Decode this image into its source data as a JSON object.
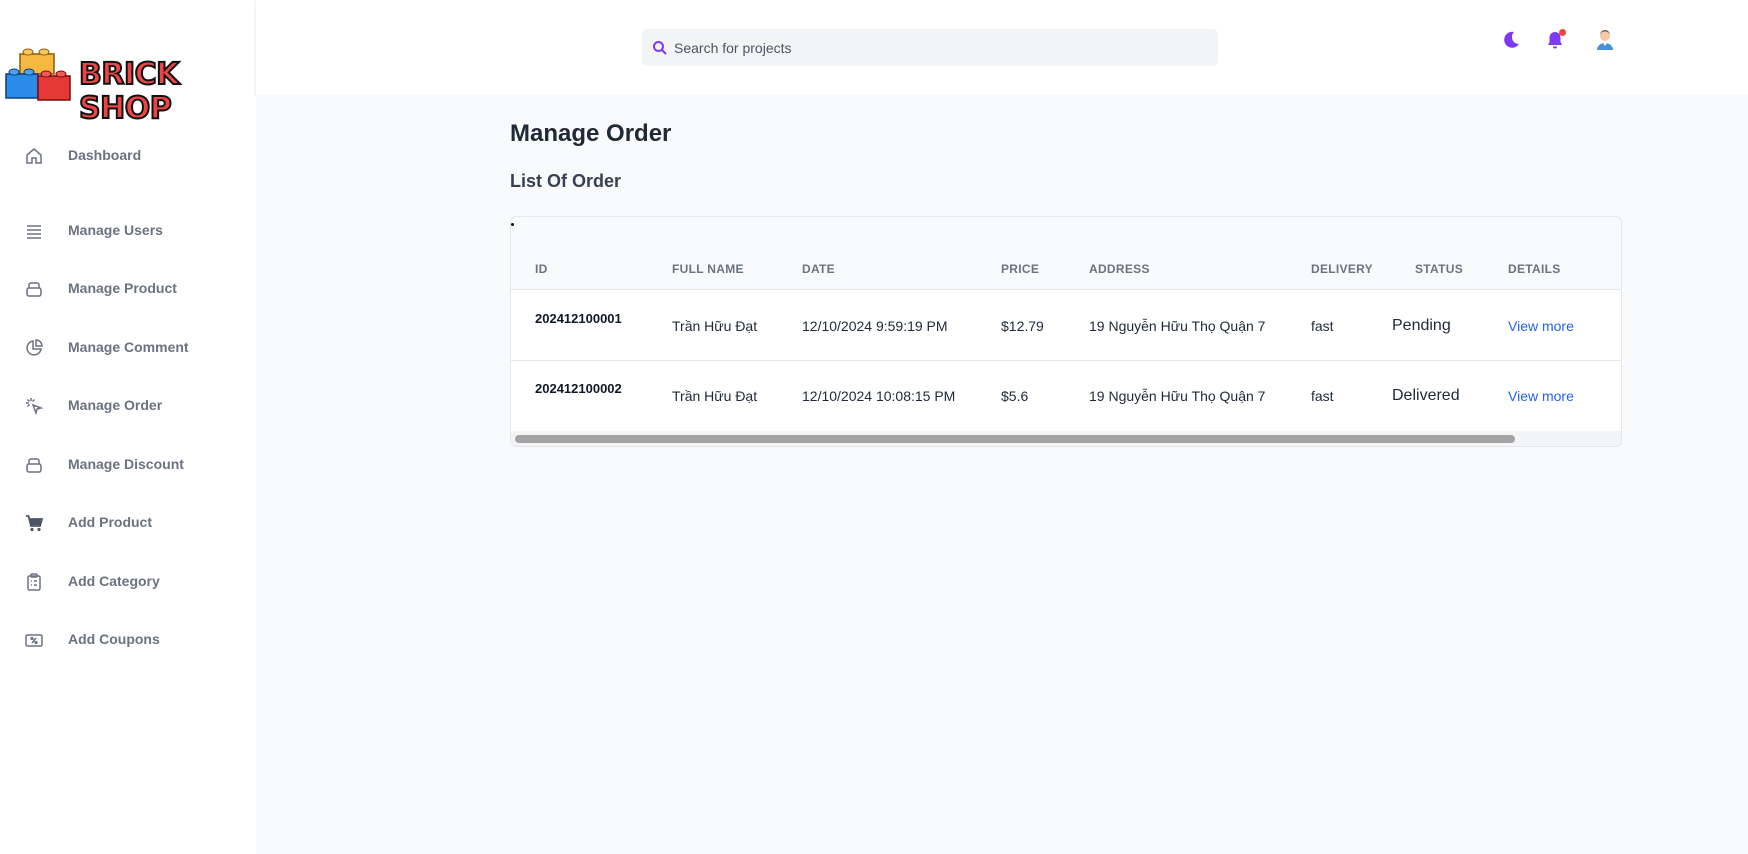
{
  "brand": {
    "name": "BRICK SHOP"
  },
  "sidebar": {
    "items": [
      {
        "label": "Dashboard",
        "icon": "home-icon"
      },
      {
        "label": "Manage Users",
        "icon": "list-icon"
      },
      {
        "label": "Manage Product",
        "icon": "box-icon"
      },
      {
        "label": "Manage Comment",
        "icon": "pie-chart-icon"
      },
      {
        "label": "Manage Order",
        "icon": "cursor-click-icon"
      },
      {
        "label": "Manage Discount",
        "icon": "box-icon"
      },
      {
        "label": "Add Product",
        "icon": "cart-icon"
      },
      {
        "label": "Add Category",
        "icon": "clipboard-icon"
      },
      {
        "label": "Add Coupons",
        "icon": "percent-tag-icon"
      }
    ]
  },
  "header": {
    "search": {
      "placeholder": "Search for projects",
      "value": ""
    },
    "icons": [
      "moon-icon",
      "bell-icon",
      "avatar-icon"
    ],
    "accent_color": "#7e3af2"
  },
  "main": {
    "title": "Manage Order",
    "subtitle": "List Of Order",
    "table": {
      "headers": {
        "id": "ID",
        "full_name": "FULL NAME",
        "date": "DATE",
        "price": "PRICE",
        "address": "ADDRESS",
        "delivery": "DELIVERY",
        "status": "STATUS",
        "details": "DETAILS"
      },
      "rows": [
        {
          "id": "202412100001",
          "full_name": "Trần Hữu Đạt",
          "date": "12/10/2024 9:59:19 PM",
          "price": "$12.79",
          "address": "19 Nguyễn Hữu Thọ Quận 7",
          "delivery": "fast",
          "status": "Pending",
          "details": "View more"
        },
        {
          "id": "202412100002",
          "full_name": "Trần Hữu Đạt",
          "date": "12/10/2024 10:08:15 PM",
          "price": "$5.6",
          "address": "19 Nguyễn Hữu Thọ Quận 7",
          "delivery": "fast",
          "status": "Delivered",
          "details": "View more"
        }
      ]
    }
  }
}
